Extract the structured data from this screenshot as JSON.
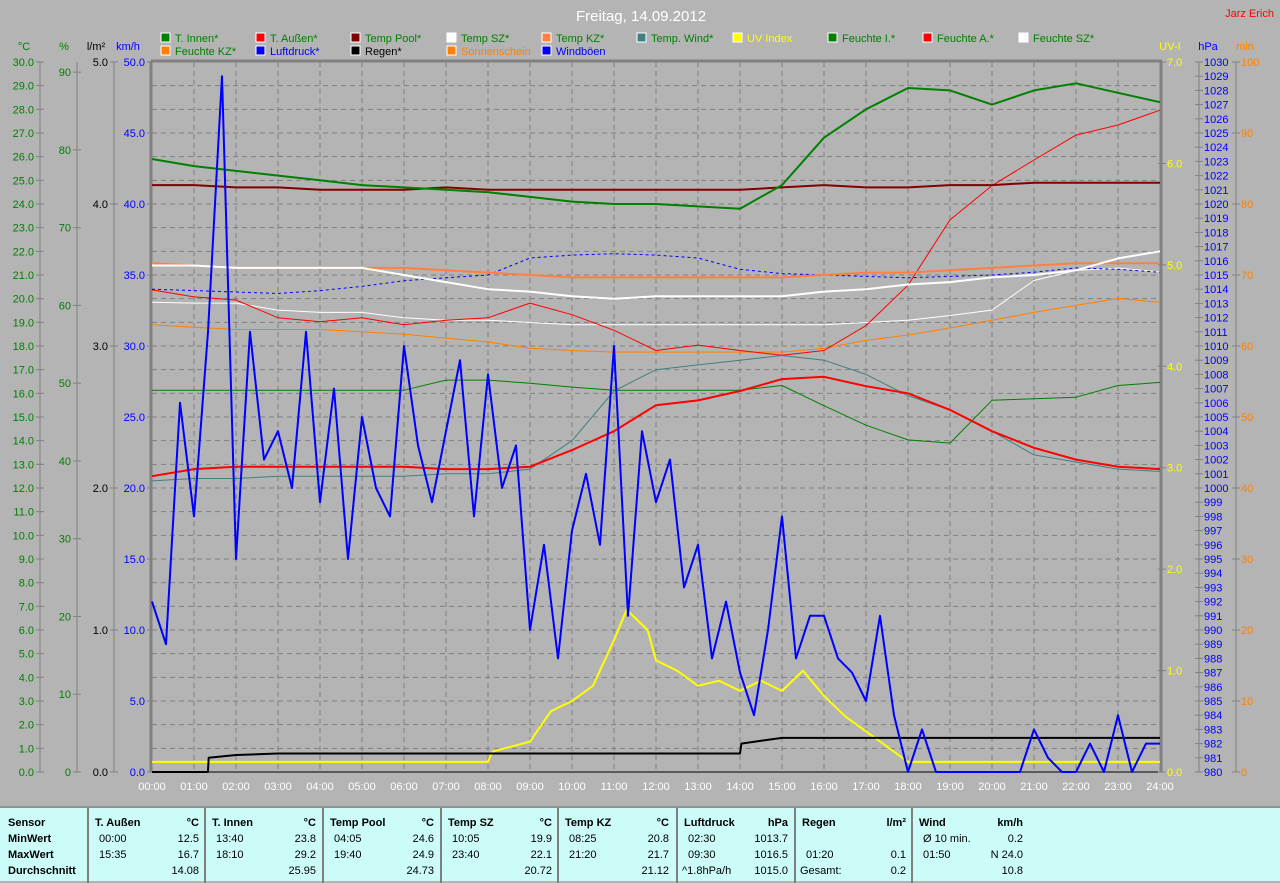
{
  "header": {
    "title": "Freitag, 14.09.2012",
    "author": "Jarz Erich"
  },
  "colors": {
    "background": "#b4b4b4",
    "grid": "#808080",
    "table_bg": "#ccfcf8"
  },
  "chart_data": {
    "type": "line",
    "title": "Freitag, 14.09.2012",
    "xlabel": "",
    "xlim": [
      0,
      24
    ],
    "x_ticks": [
      "00:00",
      "01:00",
      "02:00",
      "03:00",
      "04:00",
      "05:00",
      "06:00",
      "07:00",
      "08:00",
      "09:00",
      "10:00",
      "11:00",
      "12:00",
      "13:00",
      "14:00",
      "15:00",
      "16:00",
      "17:00",
      "18:00",
      "19:00",
      "20:00",
      "21:00",
      "22:00",
      "23:00",
      "24:00"
    ],
    "grid": true,
    "legend_placement": "top",
    "axes": [
      {
        "id": "temp",
        "unit": "°C",
        "min": 0,
        "max": 30,
        "step": 1,
        "decimals": 1,
        "color": "#008000"
      },
      {
        "id": "hum",
        "unit": "%",
        "min": 0,
        "max": 91.3,
        "step": 10,
        "decimals": 0,
        "color": "#008000"
      },
      {
        "id": "rain",
        "unit": "l/m²",
        "min": 0,
        "max": 5,
        "step": 1,
        "decimals": 1,
        "color": "#000000"
      },
      {
        "id": "wind",
        "unit": "km/h",
        "min": 0,
        "max": 50,
        "step": 5,
        "decimals": 1,
        "color": "#0000ff"
      },
      {
        "id": "uv",
        "unit": "UV-I",
        "min": 0,
        "max": 7,
        "step": 1,
        "decimals": 1,
        "color": "#ffff00"
      },
      {
        "id": "hpa",
        "unit": "hPa",
        "min": 980,
        "max": 1030,
        "step": 1,
        "decimals": 0,
        "color": "#0000ff"
      },
      {
        "id": "min",
        "unit": "min",
        "min": 0,
        "max": 100,
        "step": 10,
        "decimals": 0,
        "color": "#ff8000"
      }
    ],
    "legend": [
      {
        "label": "T. Innen*",
        "swatch": "#008000",
        "text_color": "#008000"
      },
      {
        "label": "T. Außen*",
        "swatch": "#ff0000",
        "text_color": "#008000"
      },
      {
        "label": "Temp Pool*",
        "swatch": "#800000",
        "text_color": "#008000"
      },
      {
        "label": "Temp SZ*",
        "swatch": "#ffffff",
        "text_color": "#008000"
      },
      {
        "label": "Temp KZ*",
        "swatch": "#ff8040",
        "text_color": "#008000"
      },
      {
        "label": "Temp. Wind*",
        "swatch": "#408080",
        "text_color": "#008000"
      },
      {
        "label": "UV Index",
        "swatch": "#ffff00",
        "text_color": "#ffff00"
      },
      {
        "label": "Feuchte I.*",
        "swatch": "#008000",
        "text_color": "#008000"
      },
      {
        "label": "Feuchte A.*",
        "swatch": "#ff0000",
        "text_color": "#008000"
      },
      {
        "label": "Feuchte SZ*",
        "swatch": "#ffffff",
        "text_color": "#008000"
      },
      {
        "label": "Feuchte KZ*",
        "swatch": "#ff8000",
        "text_color": "#008000"
      },
      {
        "label": "Luftdruck*",
        "swatch": "#0000ff",
        "text_color": "#0000ff"
      },
      {
        "label": "Regen*",
        "swatch": "#000000",
        "text_color": "#000000"
      },
      {
        "label": "Sonnenschein",
        "swatch": "#ff8000",
        "text_color": "#ff8000"
      },
      {
        "label": "Windböen",
        "swatch": "#0000ff",
        "text_color": "#0000ff"
      }
    ],
    "series": [
      {
        "name": "Feuchte KZ",
        "axis": "hum",
        "color": "#ff8000",
        "width": 1,
        "interval_h": 1,
        "values": [
          57.5,
          57.2,
          56.9,
          56.9,
          56.9,
          56.6,
          56.3,
          55.8,
          55.3,
          54.5,
          54.2,
          54.0,
          54.0,
          54.0,
          54.0,
          54.0,
          54.5,
          55.5,
          56.2,
          57.1,
          58.1,
          59.1,
          60.0,
          60.9,
          60.4
        ]
      },
      {
        "name": "Feuchte SZ",
        "axis": "hum",
        "color": "#ffffff",
        "width": 1,
        "interval_h": 1,
        "values": [
          60.4,
          60.3,
          60.3,
          59.4,
          59.1,
          59.1,
          58.4,
          58.1,
          58.1,
          57.8,
          57.5,
          57.5,
          57.5,
          57.5,
          57.5,
          57.5,
          57.5,
          57.8,
          58.1,
          58.7,
          59.4,
          63.2,
          64.5,
          64.8,
          64.3
        ]
      },
      {
        "name": "Feuchte A.",
        "axis": "hum",
        "color": "#ff0000",
        "width": 1,
        "interval_h": 1,
        "values": [
          62.0,
          61.1,
          60.7,
          58.4,
          57.9,
          58.4,
          57.5,
          58.1,
          58.4,
          60.3,
          58.8,
          56.8,
          54.2,
          54.9,
          54.2,
          53.6,
          54.2,
          57.4,
          62.6,
          71.0,
          75.4,
          78.7,
          81.9,
          83.2,
          85.1
        ]
      },
      {
        "name": "Feuchte I.",
        "axis": "hum",
        "color": "#008000",
        "width": 1,
        "interval_h": 1,
        "values": [
          49.1,
          49.1,
          49.1,
          49.1,
          49.1,
          49.1,
          49.1,
          50.4,
          50.4,
          50.0,
          49.5,
          49.1,
          49.1,
          49.1,
          49.1,
          49.7,
          47.1,
          44.6,
          42.7,
          42.3,
          47.8,
          48.0,
          48.2,
          49.7,
          50.1
        ]
      },
      {
        "name": "Temp. Wind",
        "axis": "temp",
        "color": "#408080",
        "width": 1,
        "interval_h": 1,
        "values": [
          12.3,
          12.4,
          12.4,
          12.5,
          12.5,
          12.5,
          12.5,
          12.6,
          12.6,
          12.8,
          14.0,
          16.1,
          17.0,
          17.2,
          17.4,
          17.6,
          17.4,
          16.8,
          15.9,
          15.3,
          14.4,
          13.4,
          13.1,
          12.8,
          12.7
        ]
      },
      {
        "name": "Luftdruck",
        "axis": "hpa",
        "color": "#0000ff",
        "width": 1,
        "dash": true,
        "interval_h": 1,
        "values": [
          1014.0,
          1013.9,
          1013.8,
          1013.7,
          1013.9,
          1014.2,
          1014.6,
          1014.8,
          1015.0,
          1016.2,
          1016.4,
          1016.5,
          1016.4,
          1016.2,
          1015.4,
          1015.1,
          1015.0,
          1014.9,
          1014.8,
          1014.9,
          1015.0,
          1015.2,
          1015.5,
          1015.4,
          1015.2
        ]
      },
      {
        "name": "Temp Pool",
        "axis": "temp",
        "color": "#800000",
        "width": 2,
        "interval_h": 1,
        "values": [
          24.8,
          24.8,
          24.7,
          24.7,
          24.6,
          24.6,
          24.6,
          24.7,
          24.6,
          24.6,
          24.6,
          24.6,
          24.6,
          24.6,
          24.6,
          24.7,
          24.8,
          24.7,
          24.7,
          24.8,
          24.8,
          24.9,
          24.9,
          24.9,
          24.9
        ]
      },
      {
        "name": "Temp KZ",
        "axis": "temp",
        "color": "#ff8040",
        "width": 2,
        "interval_h": 1,
        "values": [
          21.5,
          21.4,
          21.3,
          21.3,
          21.3,
          21.3,
          21.3,
          21.2,
          21.1,
          21.0,
          20.9,
          20.9,
          20.9,
          20.9,
          20.9,
          20.9,
          21.0,
          21.1,
          21.1,
          21.2,
          21.3,
          21.4,
          21.5,
          21.5,
          21.5
        ]
      },
      {
        "name": "Temp SZ",
        "axis": "temp",
        "color": "#ffffff",
        "width": 2,
        "interval_h": 1,
        "values": [
          21.4,
          21.4,
          21.3,
          21.3,
          21.3,
          21.3,
          21.0,
          20.7,
          20.4,
          20.3,
          20.1,
          20.0,
          20.1,
          20.1,
          20.1,
          20.1,
          20.3,
          20.4,
          20.6,
          20.7,
          20.9,
          21.0,
          21.2,
          21.7,
          22.0
        ]
      },
      {
        "name": "T. Außen",
        "axis": "temp",
        "color": "#ff0000",
        "width": 2,
        "interval_h": 1,
        "values": [
          12.5,
          12.8,
          12.9,
          12.9,
          12.9,
          12.9,
          12.9,
          12.8,
          12.8,
          12.9,
          13.6,
          14.4,
          15.5,
          15.7,
          16.1,
          16.6,
          16.7,
          16.3,
          16.0,
          15.3,
          14.4,
          13.7,
          13.2,
          12.9,
          12.8
        ]
      },
      {
        "name": "T. Innen",
        "axis": "temp",
        "color": "#008000",
        "width": 2,
        "interval_h": 1,
        "values": [
          25.9,
          25.6,
          25.4,
          25.2,
          25.0,
          24.8,
          24.7,
          24.6,
          24.5,
          24.3,
          24.1,
          24.0,
          24.0,
          23.9,
          23.8,
          24.8,
          26.8,
          28.0,
          28.9,
          28.8,
          28.2,
          28.8,
          29.1,
          28.7,
          28.3
        ]
      },
      {
        "name": "UV Index",
        "axis": "uv",
        "color": "#ffff00",
        "width": 2,
        "points": [
          [
            0,
            0.1
          ],
          [
            8,
            0.1
          ],
          [
            8.1,
            0.2
          ],
          [
            9,
            0.3
          ],
          [
            9.5,
            0.6
          ],
          [
            10,
            0.7
          ],
          [
            10.5,
            0.85
          ],
          [
            11,
            1.3
          ],
          [
            11.3,
            1.6
          ],
          [
            11.8,
            1.4
          ],
          [
            12,
            1.1
          ],
          [
            12.5,
            1.0
          ],
          [
            13,
            0.85
          ],
          [
            13.5,
            0.9
          ],
          [
            14,
            0.8
          ],
          [
            14.5,
            0.9
          ],
          [
            15,
            0.8
          ],
          [
            15.5,
            1.0
          ],
          [
            16,
            0.75
          ],
          [
            16.5,
            0.55
          ],
          [
            17,
            0.4
          ],
          [
            17.5,
            0.25
          ],
          [
            18,
            0.1
          ],
          [
            24,
            0.1
          ]
        ]
      },
      {
        "name": "Regen",
        "axis": "rain",
        "color": "#000000",
        "width": 2,
        "points": [
          [
            0,
            0
          ],
          [
            1.33,
            0
          ],
          [
            1.35,
            0.1
          ],
          [
            2,
            0.12
          ],
          [
            3,
            0.13
          ],
          [
            14,
            0.13
          ],
          [
            14.03,
            0.2
          ],
          [
            14.5,
            0.22
          ],
          [
            15,
            0.24
          ],
          [
            24,
            0.24
          ]
        ]
      },
      {
        "name": "Windböen",
        "axis": "wind",
        "color": "#0000ff",
        "width": 2,
        "interval_h": 0.3333333,
        "values": [
          12,
          9,
          26,
          18,
          31,
          49,
          15,
          31,
          22,
          24,
          20,
          31,
          19,
          27,
          15,
          25,
          20,
          18,
          30,
          23,
          19,
          24,
          29,
          18,
          28,
          20,
          23,
          10,
          16,
          8,
          17,
          21,
          16,
          30,
          11,
          24,
          19,
          22,
          13,
          16,
          8,
          12,
          7,
          4,
          10,
          18,
          8,
          11,
          11,
          8,
          7,
          5,
          11,
          4,
          0,
          3,
          0,
          0,
          0,
          0,
          0,
          0,
          0,
          3,
          1,
          0,
          0,
          2,
          0,
          4,
          0,
          2,
          2
        ]
      }
    ]
  },
  "table": {
    "row_labels": [
      "Sensor",
      "MinWert",
      "MaxWert",
      "Durchschnitt"
    ],
    "sections": [
      {
        "name": "T. Außen",
        "unit": "°C",
        "min_label": "00:00",
        "min": "12.5",
        "max_label": "15:35",
        "max": "16.7",
        "avg_label": "",
        "avg": "14.08"
      },
      {
        "name": "T. Innen",
        "unit": "°C",
        "min_label": "13:40",
        "min": "23.8",
        "max_label": "18:10",
        "max": "29.2",
        "avg_label": "",
        "avg": "25.95"
      },
      {
        "name": "Temp Pool",
        "unit": "°C",
        "min_label": "04:05",
        "min": "24.6",
        "max_label": "19:40",
        "max": "24.9",
        "avg_label": "",
        "avg": "24.73"
      },
      {
        "name": "Temp SZ",
        "unit": "°C",
        "min_label": "10:05",
        "min": "19.9",
        "max_label": "23:40",
        "max": "22.1",
        "avg_label": "",
        "avg": "20.72"
      },
      {
        "name": "Temp KZ",
        "unit": "°C",
        "min_label": "08:25",
        "min": "20.8",
        "max_label": "21:20",
        "max": "21.7",
        "avg_label": "",
        "avg": "21.12"
      },
      {
        "name": "Luftdruck",
        "unit": "hPa",
        "min_label": "02:30",
        "min": "1013.7",
        "max_label": "09:30",
        "max": "1016.5",
        "avg_label": "^1.8hPa/h",
        "avg": "1015.0"
      },
      {
        "name": "Regen",
        "unit": "l/m²",
        "min_label": "",
        "min": "",
        "max_label": "01:20",
        "max": "0.1",
        "avg_label": "Gesamt:",
        "avg": "0.2"
      },
      {
        "name": "Wind",
        "unit": "km/h",
        "min_label": "Ø 10 min.",
        "min": "0.2",
        "max_label": "01:50",
        "max": "N 24.0",
        "avg_label": "",
        "avg": "10.8"
      }
    ]
  }
}
